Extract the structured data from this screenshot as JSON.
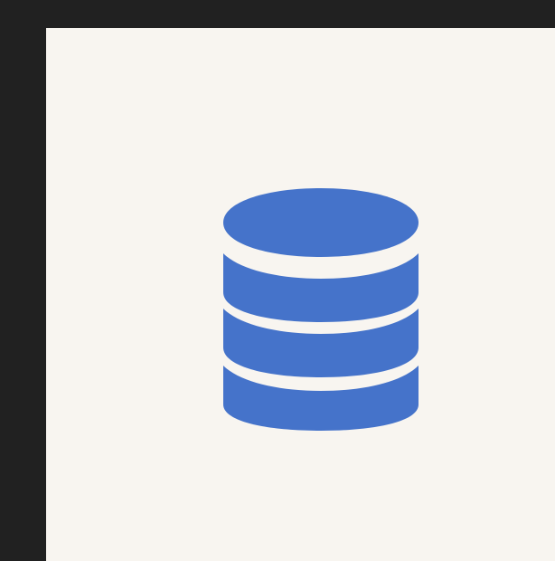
{
  "frame": {
    "chrome_color": "#212121",
    "panel_color": "#f8f5f0"
  },
  "icon": {
    "name": "database-icon",
    "color": "#4573ca"
  }
}
